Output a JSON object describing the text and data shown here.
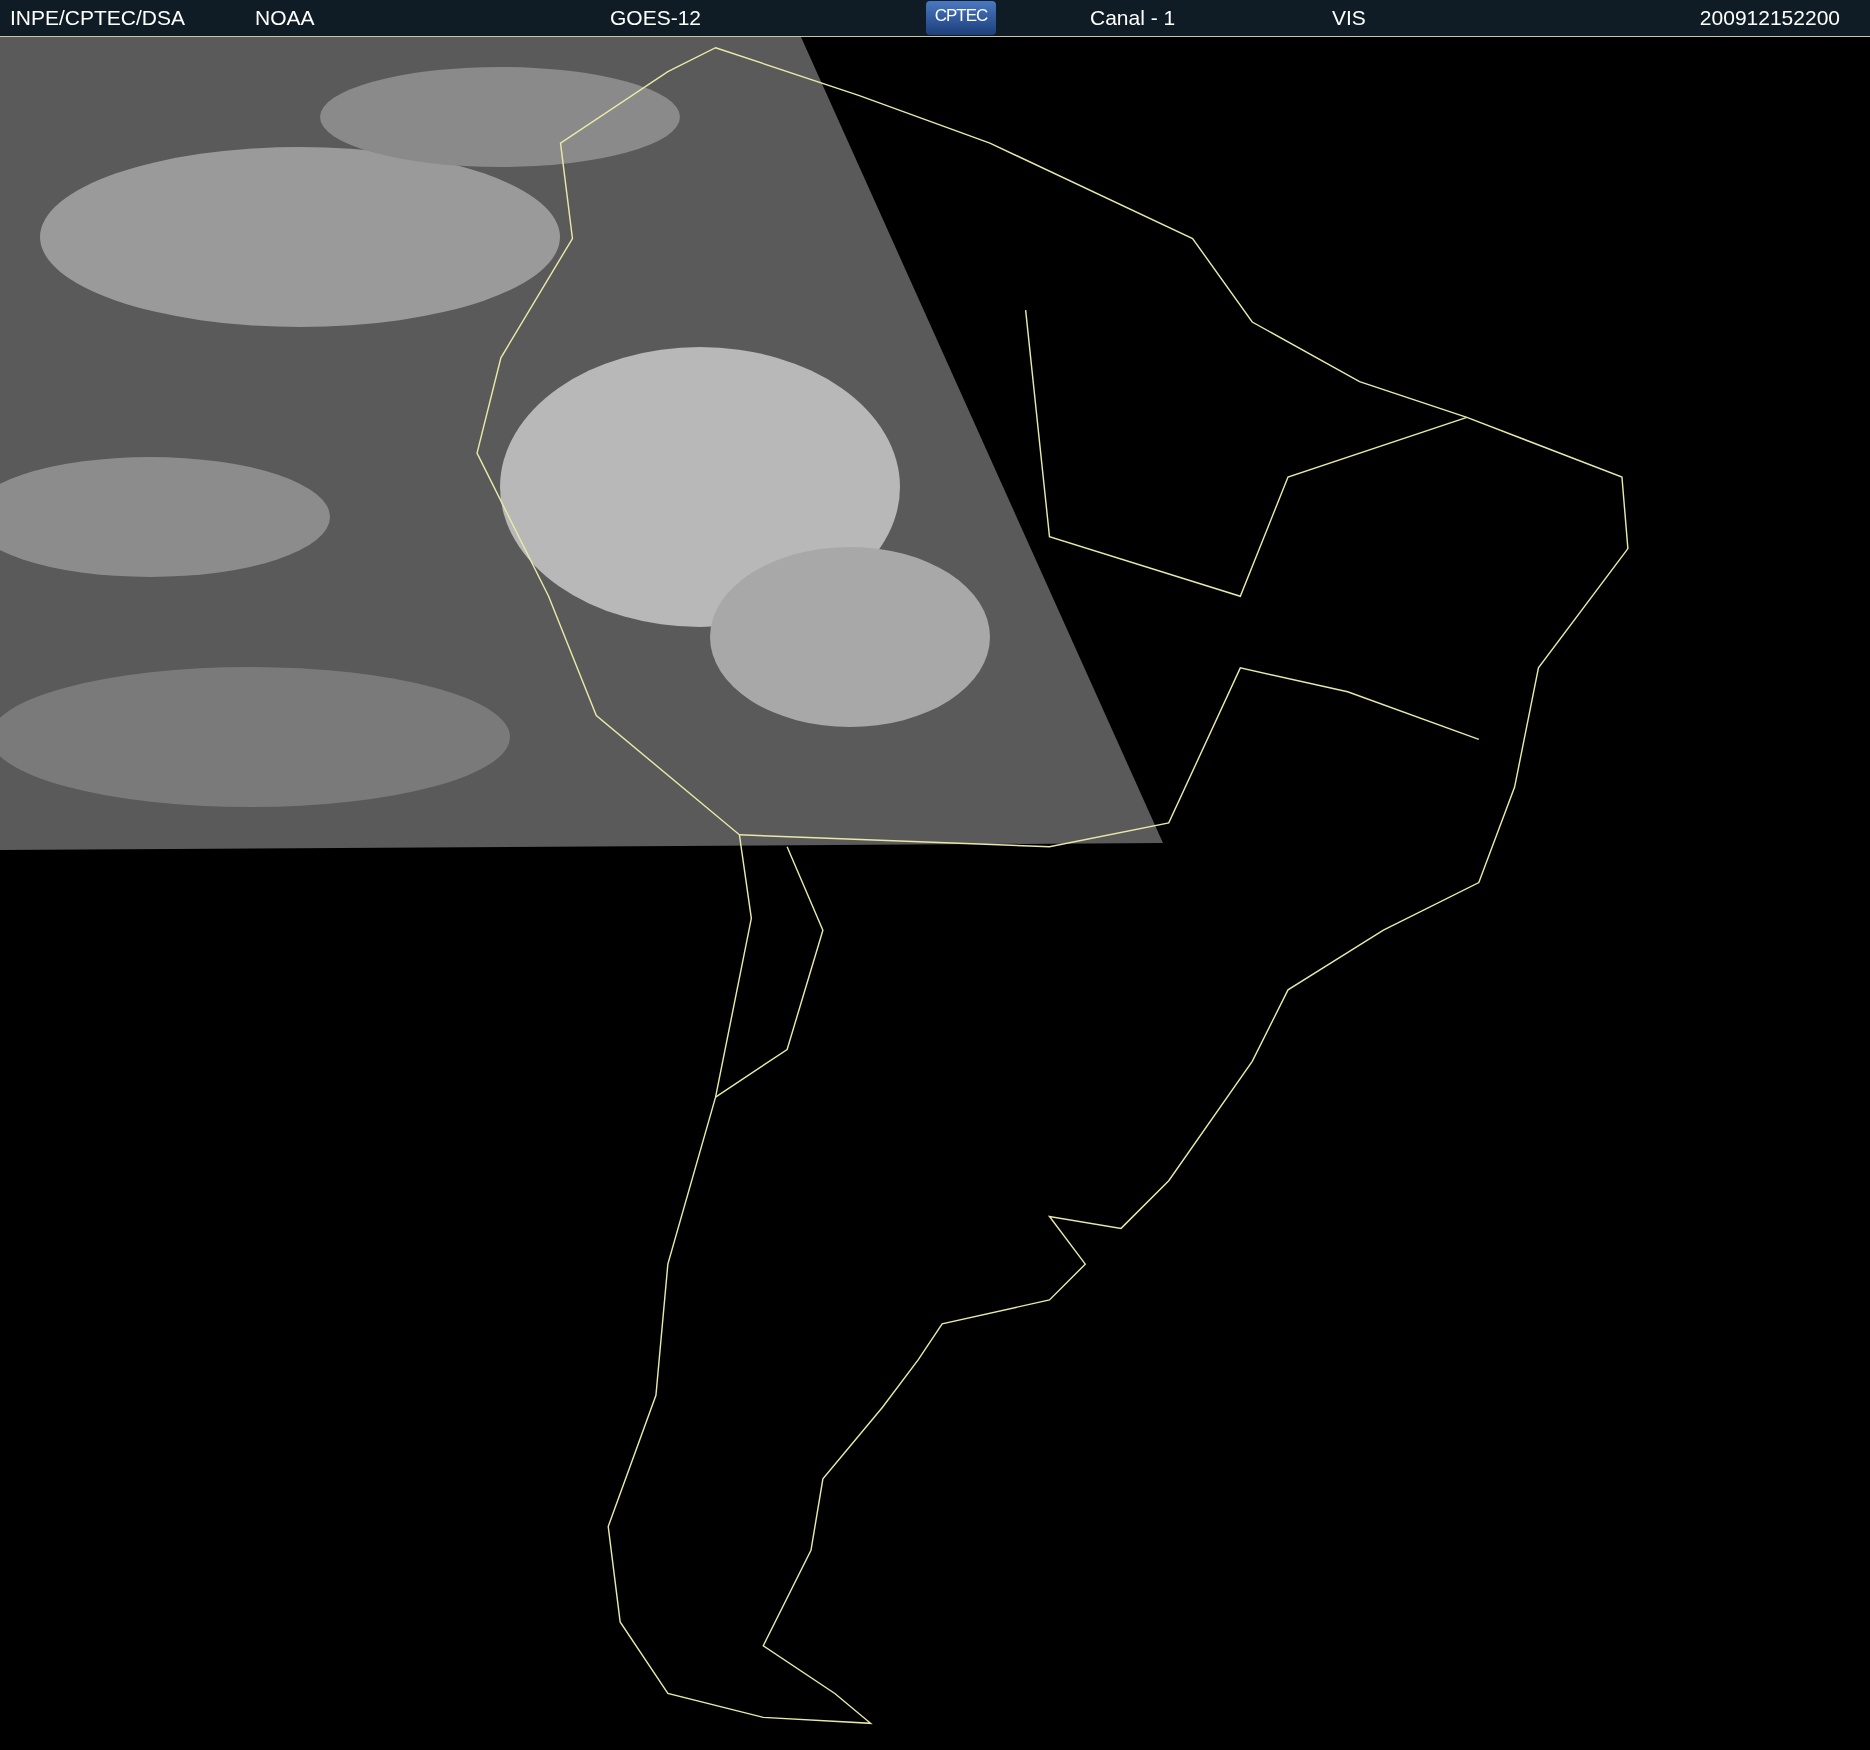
{
  "header": {
    "source": "INPE/CPTEC/DSA",
    "agency": "NOAA",
    "satellite": "GOES-12",
    "logo": "CPTEC",
    "channel": "Canal - 1",
    "band": "VIS",
    "timestamp": "200912152200"
  }
}
